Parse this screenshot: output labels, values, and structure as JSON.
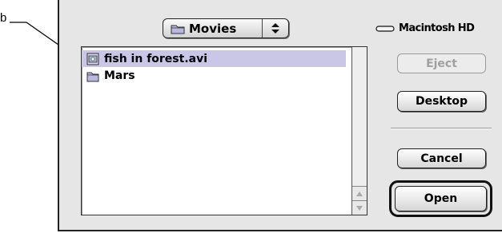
{
  "callout": {
    "label": "b"
  },
  "dialog": {
    "folder_popup": {
      "label": "Movies",
      "icon": "folder-icon"
    },
    "volume": {
      "label": "Macintosh HD",
      "icon": "hard-disk-icon"
    },
    "files": [
      {
        "name": "fish in forest.avi",
        "icon": "movie-file-icon",
        "selected": true
      },
      {
        "name": "Mars",
        "icon": "folder-icon",
        "selected": false
      }
    ],
    "buttons": {
      "eject": "Eject",
      "desktop": "Desktop",
      "cancel": "Cancel",
      "open": "Open"
    }
  },
  "colors": {
    "selection": "#c9c6e6",
    "dialog_background": "#e6e6e6",
    "disabled_text": "#a0a0a0"
  }
}
